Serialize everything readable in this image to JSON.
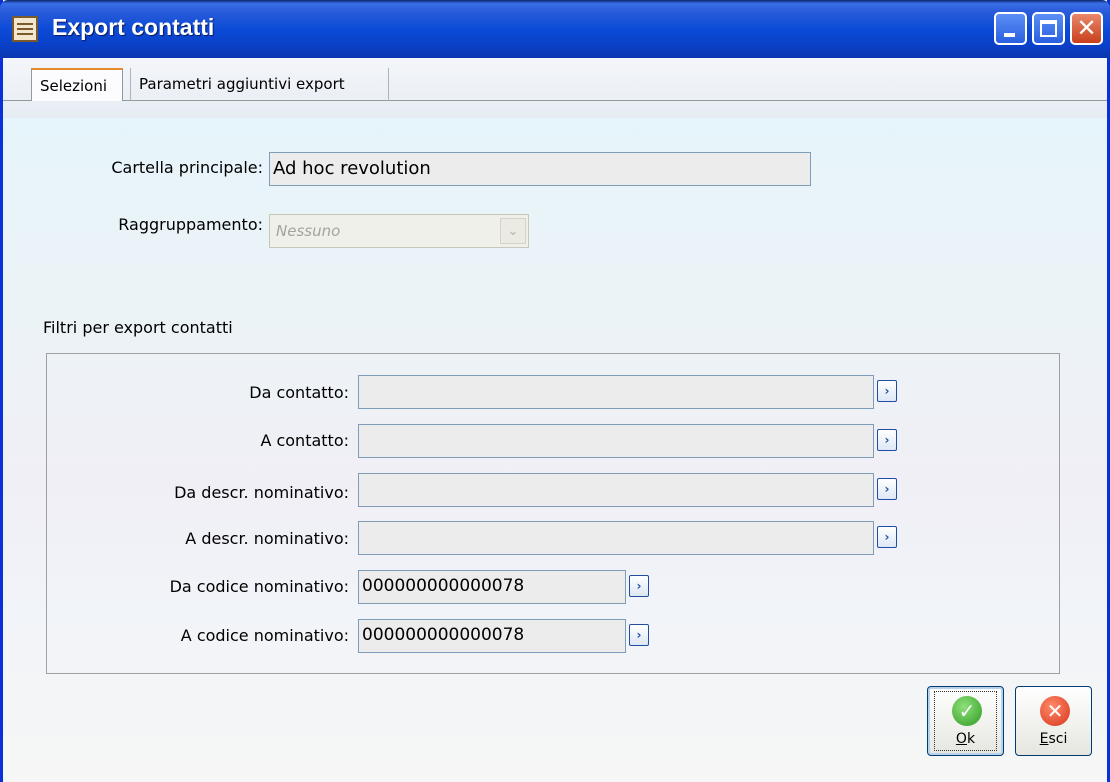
{
  "window": {
    "title": "Export contatti"
  },
  "tabs": [
    {
      "label": "Selezioni"
    },
    {
      "label": "Parametri aggiuntivi export"
    }
  ],
  "main": {
    "cartella_label": "Cartella principale:",
    "cartella_value": "Ad hoc revolution",
    "raggruppamento_label": "Raggruppamento:",
    "raggruppamento_value": "Nessuno"
  },
  "filters": {
    "title": "Filtri per export contatti",
    "rows": [
      {
        "label": "Da contatto:",
        "value": ""
      },
      {
        "label": "A contatto:",
        "value": ""
      },
      {
        "label": "Da descr. nominativo:",
        "value": ""
      },
      {
        "label": "A descr. nominativo:",
        "value": ""
      },
      {
        "label": "Da codice nominativo:",
        "value": "000000000000078"
      },
      {
        "label": "A codice nominativo:",
        "value": "000000000000078"
      }
    ]
  },
  "buttons": {
    "ok": {
      "label_u": "O",
      "label_rest": "k"
    },
    "esci": {
      "label_u": "E",
      "label_rest": "sci"
    }
  }
}
